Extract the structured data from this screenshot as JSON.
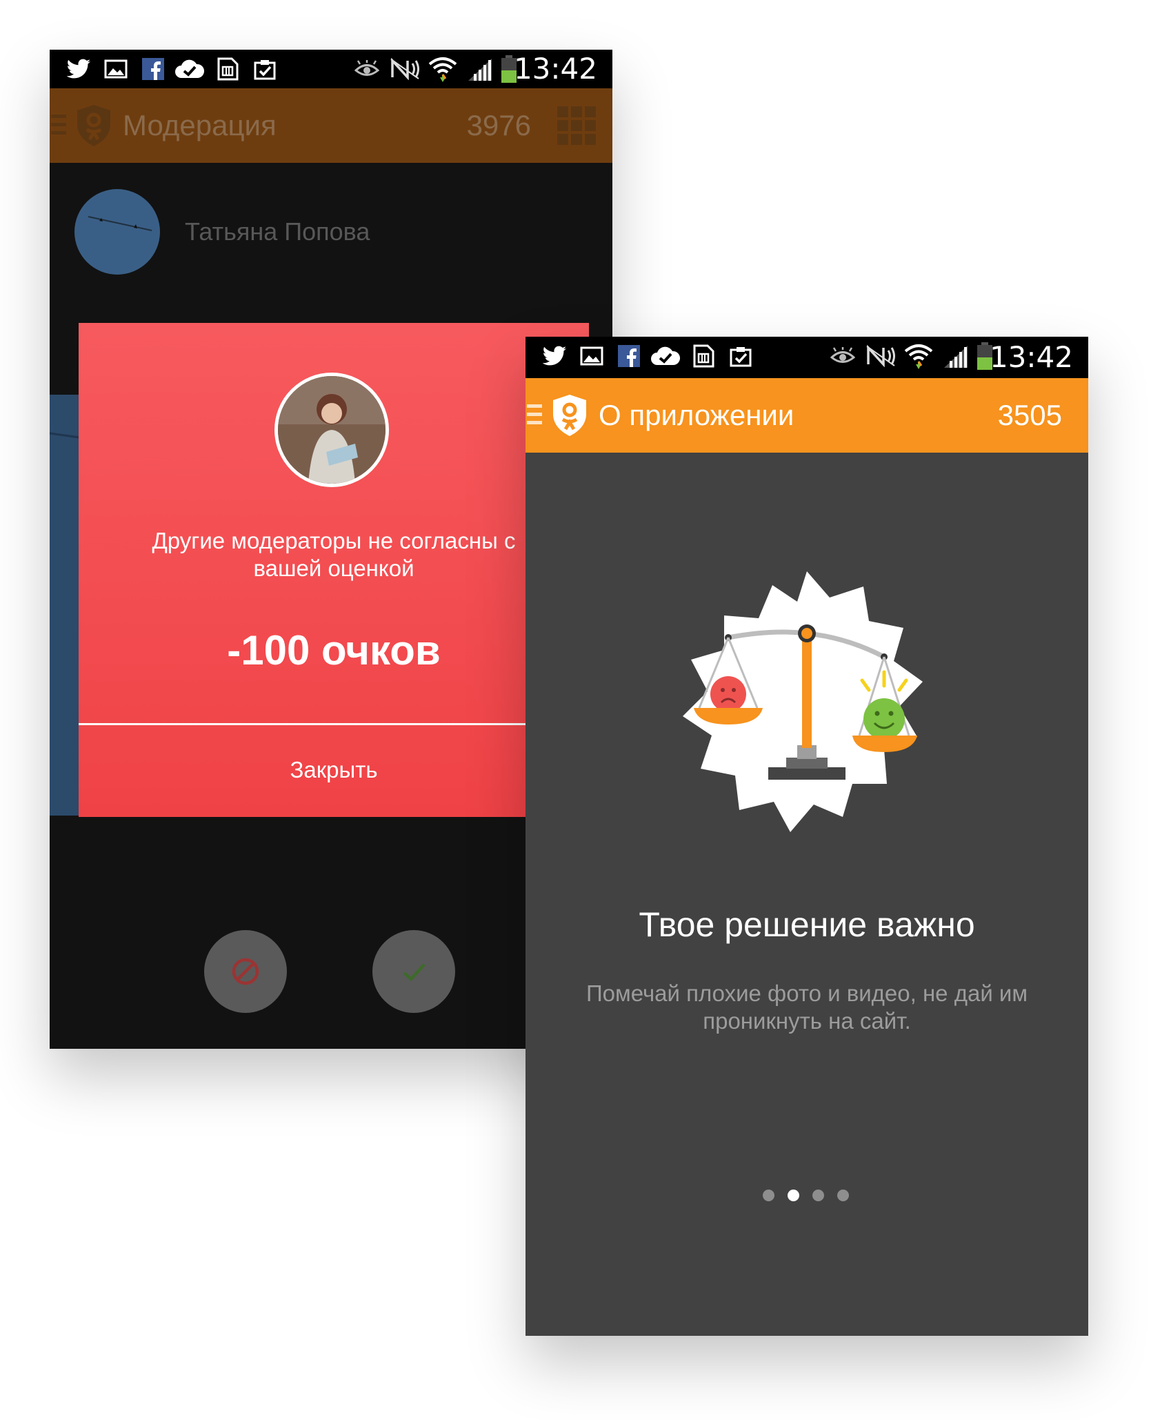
{
  "phone_back": {
    "status_time": "13:42",
    "appbar": {
      "title": "Модерация",
      "count": "3976"
    },
    "user_name": "Татьяна Попова",
    "dialog": {
      "message": "Другие модераторы не согласны с вашей оценкой",
      "score": "-100 очков",
      "close_label": "Закрыть"
    },
    "actions": {
      "reject_icon": "block-icon",
      "approve_icon": "check-icon"
    }
  },
  "phone_front": {
    "status_time": "13:42",
    "appbar": {
      "title": "О приложении",
      "count": "3505"
    },
    "headline": "Твое решение важно",
    "subtext": "Помечай плохие фото и видео, не дай им проникнуть на сайт.",
    "pager": {
      "total": 4,
      "active": 2
    }
  },
  "colors": {
    "brand_orange": "#f7931e",
    "dialog_red": "#f24b4f",
    "status_bar": "#000000"
  },
  "status_icons": [
    "twitter-icon",
    "gallery-icon",
    "facebook-icon",
    "cloud-check-icon",
    "sim-icon",
    "clipboard-check-icon",
    "eye-icon",
    "nfc-icon",
    "wifi-icon",
    "signal-icon",
    "battery-icon"
  ]
}
